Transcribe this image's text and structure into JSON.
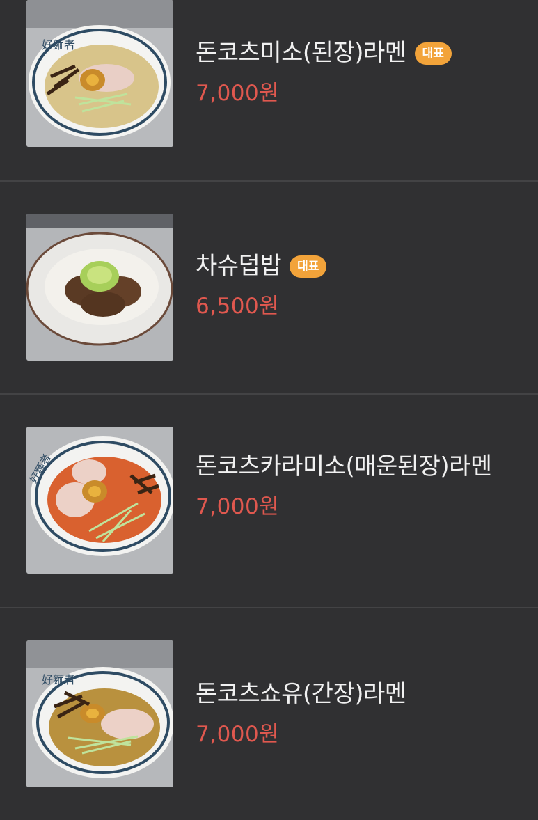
{
  "menu": {
    "items": [
      {
        "name": "돈코츠미소(된장)라멘",
        "badge": "대표",
        "price": "7,000원",
        "image": "miso-ramen-photo"
      },
      {
        "name": "차슈덥밥",
        "badge": "대표",
        "price": "6,500원",
        "image": "chashu-rice-bowl-photo"
      },
      {
        "name": "돈코츠카라미소(매운된장)라멘",
        "badge": "",
        "price": "7,000원",
        "image": "spicy-miso-ramen-photo"
      },
      {
        "name": "돈코츠쇼유(간장)라멘",
        "badge": "",
        "price": "7,000원",
        "image": "shoyu-ramen-photo"
      }
    ]
  },
  "colors": {
    "background": "#303032",
    "divider": "#434345",
    "name_text": "#f1f1f1",
    "price_text": "#e0584f",
    "badge_bg": "#f2a33a"
  }
}
